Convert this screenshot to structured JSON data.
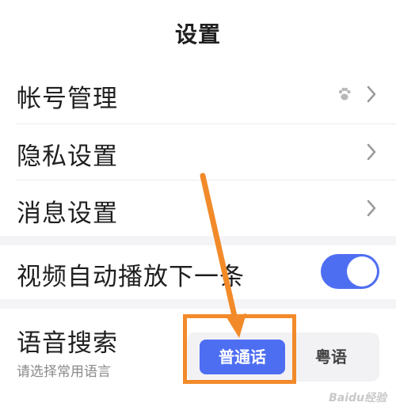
{
  "header": {
    "title": "设置"
  },
  "settings": {
    "account_label": "帐号管理",
    "privacy_label": "隐私设置",
    "message_label": "消息设置",
    "autoplay_label": "视频自动播放下一条",
    "autoplay_on": true
  },
  "voice_search": {
    "title": "语音搜索",
    "subtitle": "请选择常用语言",
    "options": [
      "普通话",
      "粤语"
    ],
    "selected": "普通话"
  },
  "icons": {
    "account_badge": "paw-icon",
    "chevron": "chevron-right-icon"
  },
  "colors": {
    "accent": "#4e6ef2",
    "highlight": "#f28a2a",
    "section_gap": "#f4f4f6"
  },
  "watermark": "Baidu经验"
}
